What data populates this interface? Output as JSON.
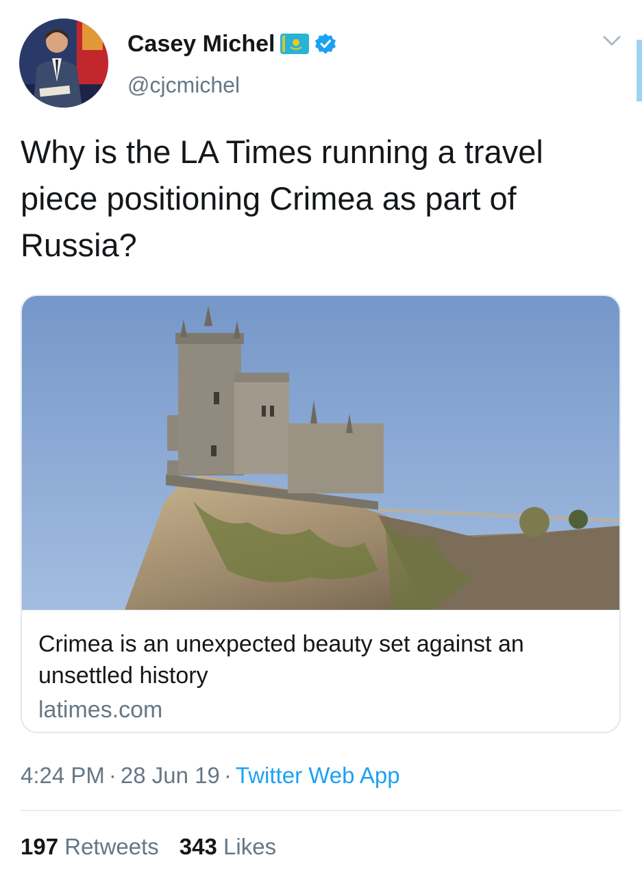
{
  "author": {
    "display_name": "Casey Michel",
    "handle": "@cjcmichel",
    "flag_icon": "kazakhstan-flag-icon",
    "verified_icon": "verified-badge-icon"
  },
  "tweet": {
    "text": "Why is the LA Times running a travel piece positioning Crimea as part of Russia?"
  },
  "link_card": {
    "image": "castle-on-cliff-photo",
    "title": "Crimea is an unexpected beauty set against an unsettled history",
    "domain": "latimes.com"
  },
  "meta": {
    "time": "4:24 PM",
    "separator": "·",
    "date": "28 Jun 19",
    "source": "Twitter Web App"
  },
  "stats": {
    "retweets_count": "197",
    "retweets_label": "Retweets",
    "likes_count": "343",
    "likes_label": "Likes"
  },
  "colors": {
    "link_blue": "#1da1f2",
    "secondary_text": "#657786",
    "border": "#e1e8ed"
  }
}
